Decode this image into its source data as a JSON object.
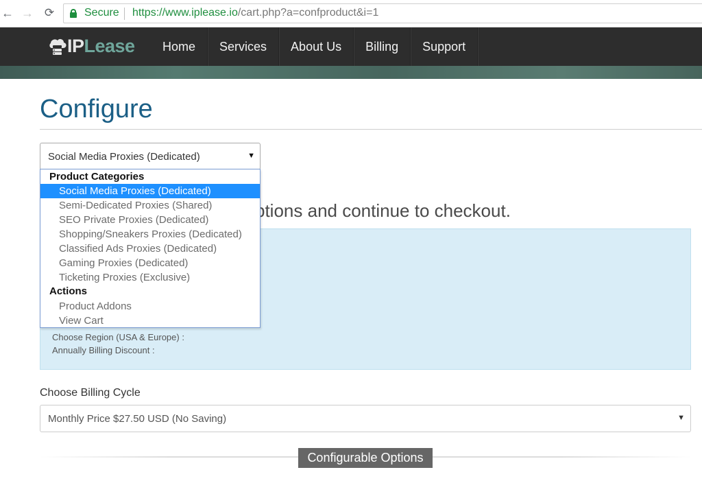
{
  "browser": {
    "back_icon": "←",
    "forward_icon": "→",
    "reload_icon": "⟳",
    "secure_label": "Secure",
    "url_host": "https://www.iplease.io",
    "url_path": "/cart.php?a=confproduct&i=1"
  },
  "site": {
    "logo_ip": "IP",
    "logo_lease": "Lease",
    "nav": [
      "Home",
      "Services",
      "About Us",
      "Billing",
      "Support"
    ],
    "colors": {
      "nav_bg": "#2d2d2d",
      "logo_accent": "#6fa69b",
      "title": "#1b5f86"
    }
  },
  "page": {
    "title": "Configure",
    "headline_fragment": "ptions and continue to checkout."
  },
  "product_select": {
    "selected": "Social Media Proxies (Dedicated)",
    "groups": [
      {
        "label": "Product Categories",
        "options": [
          "Social Media Proxies (Dedicated)",
          "Semi-Dedicated Proxies (Shared)",
          "SEO Private Proxies (Dedicated)",
          "Shopping/Sneakers Proxies (Dedicated)",
          "Classified Ads Proxies (Dedicated)",
          "Gaming Proxies (Dedicated)",
          "Ticketing Proxies (Exclusive)"
        ]
      },
      {
        "label": "Actions",
        "options": [
          "Product Addons",
          "View Cart"
        ]
      }
    ],
    "highlighted_index": 0,
    "highlight_color": "#1e90ff"
  },
  "info_panel": {
    "lines": [
      "Choose Region (USA & Europe) :",
      "Annually Billing Discount :"
    ]
  },
  "billing": {
    "label": "Choose Billing Cycle",
    "selected": "Monthly Price $27.50 USD (No Saving)"
  },
  "configurable_options": {
    "badge": "Configurable Options"
  }
}
